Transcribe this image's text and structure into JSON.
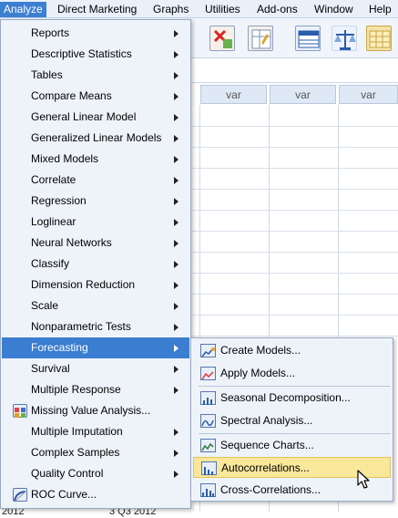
{
  "menubar": {
    "items": [
      {
        "label": "Analyze"
      },
      {
        "label": "Direct Marketing"
      },
      {
        "label": "Graphs"
      },
      {
        "label": "Utilities"
      },
      {
        "label": "Add-ons"
      },
      {
        "label": "Window"
      },
      {
        "label": "Help"
      }
    ]
  },
  "grid": {
    "columns": [
      "var",
      "var",
      "var"
    ]
  },
  "analyze_menu": {
    "items": [
      {
        "label": "Reports"
      },
      {
        "label": "Descriptive Statistics"
      },
      {
        "label": "Tables"
      },
      {
        "label": "Compare Means"
      },
      {
        "label": "General Linear Model"
      },
      {
        "label": "Generalized Linear Models"
      },
      {
        "label": "Mixed Models"
      },
      {
        "label": "Correlate"
      },
      {
        "label": "Regression"
      },
      {
        "label": "Loglinear"
      },
      {
        "label": "Neural Networks"
      },
      {
        "label": "Classify"
      },
      {
        "label": "Dimension Reduction"
      },
      {
        "label": "Scale"
      },
      {
        "label": "Nonparametric Tests"
      },
      {
        "label": "Forecasting"
      },
      {
        "label": "Survival"
      },
      {
        "label": "Multiple Response"
      },
      {
        "label": "Missing Value Analysis..."
      },
      {
        "label": "Multiple Imputation"
      },
      {
        "label": "Complex Samples"
      },
      {
        "label": "Quality Control"
      },
      {
        "label": "ROC Curve..."
      }
    ]
  },
  "forecasting_submenu": {
    "items": [
      {
        "label": "Create Models..."
      },
      {
        "label": "Apply Models..."
      },
      {
        "label": "Seasonal Decomposition..."
      },
      {
        "label": "Spectral Analysis..."
      },
      {
        "label": "Sequence Charts..."
      },
      {
        "label": "Autocorrelations..."
      },
      {
        "label": "Cross-Correlations..."
      }
    ]
  },
  "status": {
    "left": "2012",
    "right": "3 Q3 2012"
  },
  "colors": {
    "menu_highlight": "#3b7dd0",
    "submenu_highlight": "#f9e79a",
    "menu_background": "#eef3fa"
  }
}
